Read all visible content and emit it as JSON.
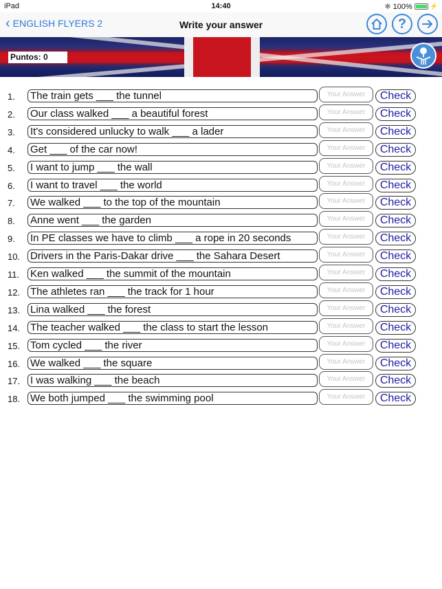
{
  "status_bar": {
    "device": "iPad",
    "time": "14:40",
    "battery_percent": "100%",
    "battery_level": 1.0
  },
  "nav": {
    "back_label": "ENGLISH FLYERS 2",
    "title": "Write your answer",
    "icons": [
      "home-icon",
      "help-icon",
      "next-arrow-icon"
    ]
  },
  "banner": {
    "score_label": "Puntos: 0"
  },
  "answer_placeholder": "Your Answer",
  "check_label": "Check",
  "questions": [
    {
      "num": "1.",
      "text": "The train gets ___ the tunnel"
    },
    {
      "num": "2.",
      "text": "Our class walked ___ a beautiful forest"
    },
    {
      "num": "3.",
      "text": "It's considered unlucky to walk ___ a lader"
    },
    {
      "num": "4.",
      "text": "Get ___ of the car now!"
    },
    {
      "num": "5.",
      "text": "I want to jump ___ the wall"
    },
    {
      "num": "6.",
      "text": "I want to travel ___ the world"
    },
    {
      "num": "7.",
      "text": "We walked ___ to the top of the mountain"
    },
    {
      "num": "8.",
      "text": "Anne went ___ the garden"
    },
    {
      "num": "9.",
      "text": "In PE classes we have to climb ___ a rope in 20 seconds"
    },
    {
      "num": "10.",
      "text": "Drivers in the Paris-Dakar drive ___ the Sahara Desert"
    },
    {
      "num": "11.",
      "text": "Ken walked ___ the summit of the mountain"
    },
    {
      "num": "12.",
      "text": "The athletes ran ___ the track for 1 hour"
    },
    {
      "num": "13.",
      "text": "Lina walked ___ the forest"
    },
    {
      "num": "14.",
      "text": "The teacher walked ___ the class to start the lesson"
    },
    {
      "num": "15.",
      "text": "Tom cycled ___ the river"
    },
    {
      "num": "16.",
      "text": "We walked ___ the square"
    },
    {
      "num": "17.",
      "text": "I was walking ___ the beach"
    },
    {
      "num": "18.",
      "text": "We both jumped ___ the swimming pool"
    }
  ]
}
